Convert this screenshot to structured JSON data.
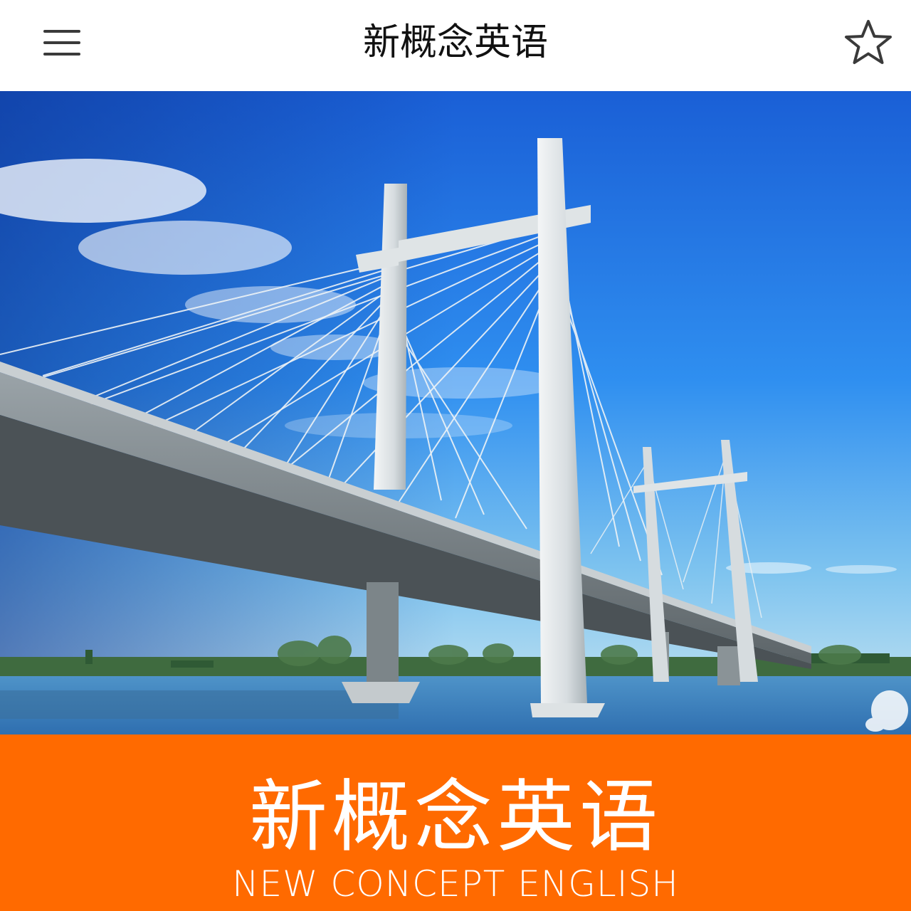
{
  "header": {
    "title": "新概念英语",
    "menu_icon": "hamburger-icon",
    "favorite_icon": "star-outline-icon"
  },
  "banner": {
    "subject": "cable-stayed bridge over river under blue sky"
  },
  "brand": {
    "title_cn": "新概念英语",
    "title_en": "NEW CONCEPT ENGLISH",
    "background_color": "#ff6a00"
  }
}
